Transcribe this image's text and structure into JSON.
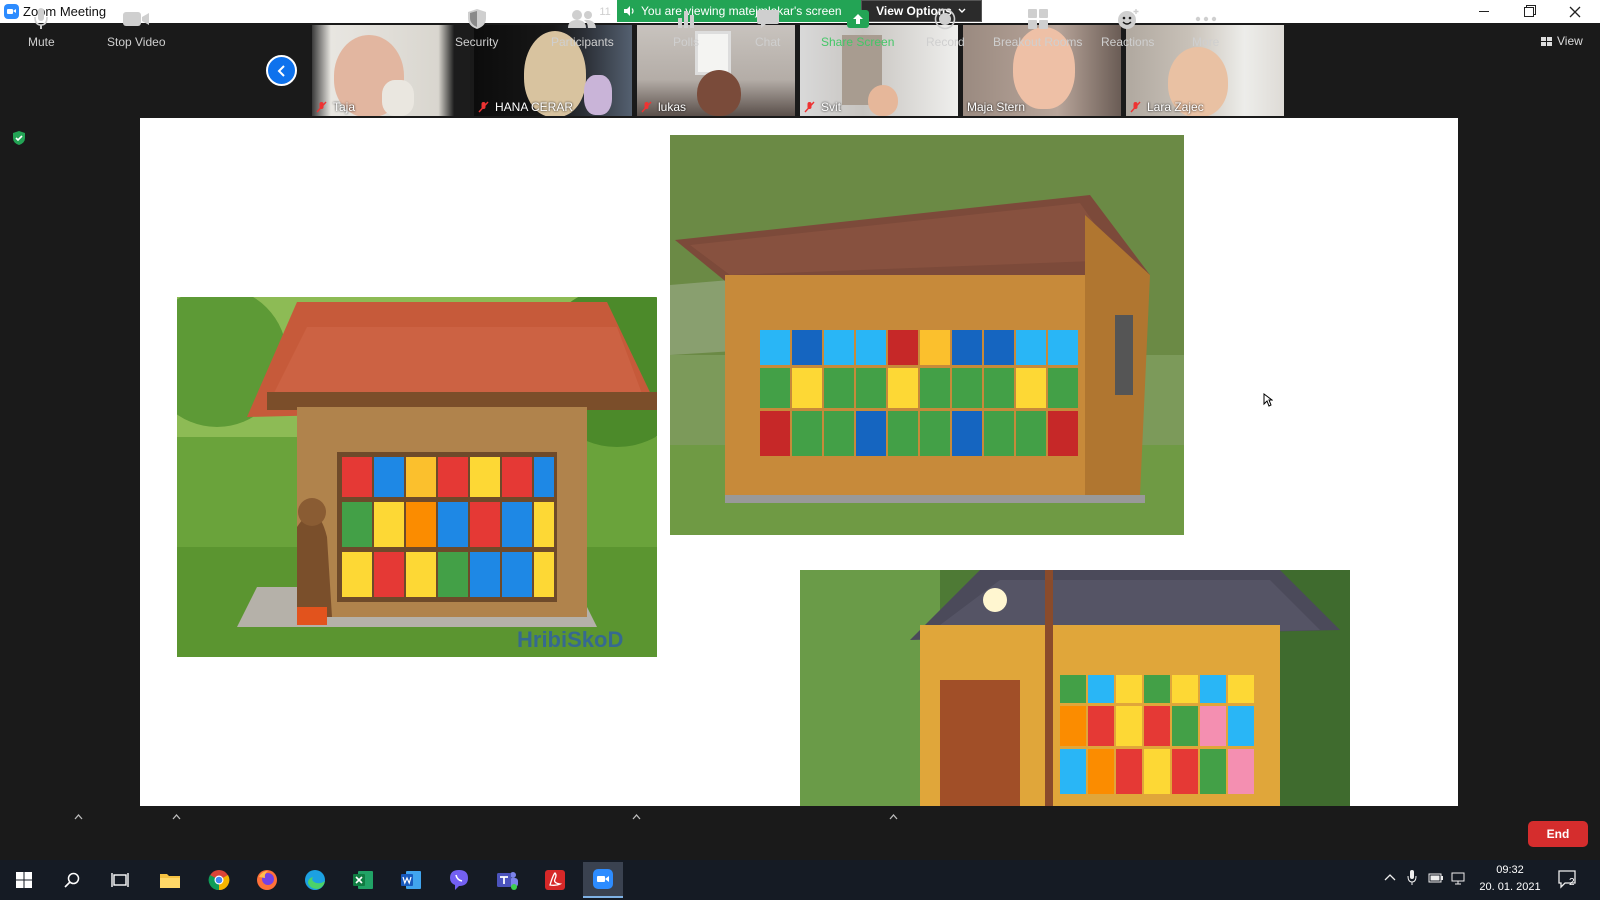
{
  "window": {
    "title": "Zoom Meeting",
    "controls": [
      "minimize",
      "restore",
      "close"
    ]
  },
  "banner": {
    "sharing_text": "You are viewing matejmlakar's screen",
    "view_options": "View Options"
  },
  "gallery": {
    "view_label": "View",
    "participants": [
      {
        "name": "Taja"
      },
      {
        "name": "HANA CERAR"
      },
      {
        "name": "lukas"
      },
      {
        "name": "Svit"
      },
      {
        "name": "Maja Stern"
      },
      {
        "name": "Lara Zajec"
      }
    ]
  },
  "shared_screen": {
    "photos": [
      "apiary-with-bear-carving",
      "apiary-log-house",
      "apiary-with-gutter"
    ],
    "watermark": "HribiSkoD"
  },
  "toolbar": {
    "mute": "Mute",
    "stop_video": "Stop Video",
    "security": "Security",
    "participants": "Participants",
    "participants_count": "11",
    "polls": "Polls",
    "chat": "Chat",
    "share_screen": "Share Screen",
    "record": "Record",
    "breakout_rooms": "Breakout Rooms",
    "reactions": "Reactions",
    "more": "More",
    "end": "End"
  },
  "taskbar": {
    "apps": [
      "start",
      "search",
      "task-view",
      "file-explorer",
      "chrome",
      "firefox",
      "edge",
      "excel",
      "word",
      "viber",
      "teams",
      "acrobat",
      "zoom"
    ],
    "time": "09:32",
    "date": "20. 01. 2021",
    "notification_count": "2"
  },
  "colors": {
    "share_green": "#23a455",
    "zoom_blue": "#0e72ed",
    "end_red": "#d52d2d"
  }
}
